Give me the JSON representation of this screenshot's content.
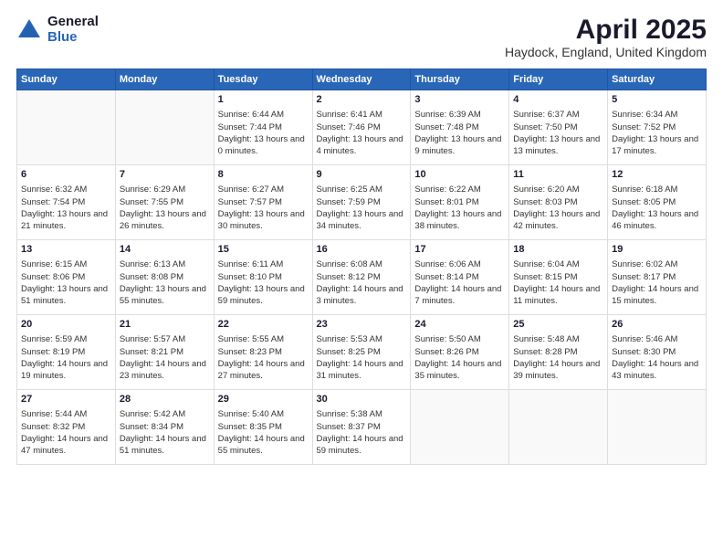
{
  "header": {
    "logo_general": "General",
    "logo_blue": "Blue",
    "month_year": "April 2025",
    "location": "Haydock, England, United Kingdom"
  },
  "weekdays": [
    "Sunday",
    "Monday",
    "Tuesday",
    "Wednesday",
    "Thursday",
    "Friday",
    "Saturday"
  ],
  "weeks": [
    [
      {
        "day": "",
        "info": ""
      },
      {
        "day": "",
        "info": ""
      },
      {
        "day": "1",
        "info": "Sunrise: 6:44 AM\nSunset: 7:44 PM\nDaylight: 13 hours and 0 minutes."
      },
      {
        "day": "2",
        "info": "Sunrise: 6:41 AM\nSunset: 7:46 PM\nDaylight: 13 hours and 4 minutes."
      },
      {
        "day": "3",
        "info": "Sunrise: 6:39 AM\nSunset: 7:48 PM\nDaylight: 13 hours and 9 minutes."
      },
      {
        "day": "4",
        "info": "Sunrise: 6:37 AM\nSunset: 7:50 PM\nDaylight: 13 hours and 13 minutes."
      },
      {
        "day": "5",
        "info": "Sunrise: 6:34 AM\nSunset: 7:52 PM\nDaylight: 13 hours and 17 minutes."
      }
    ],
    [
      {
        "day": "6",
        "info": "Sunrise: 6:32 AM\nSunset: 7:54 PM\nDaylight: 13 hours and 21 minutes."
      },
      {
        "day": "7",
        "info": "Sunrise: 6:29 AM\nSunset: 7:55 PM\nDaylight: 13 hours and 26 minutes."
      },
      {
        "day": "8",
        "info": "Sunrise: 6:27 AM\nSunset: 7:57 PM\nDaylight: 13 hours and 30 minutes."
      },
      {
        "day": "9",
        "info": "Sunrise: 6:25 AM\nSunset: 7:59 PM\nDaylight: 13 hours and 34 minutes."
      },
      {
        "day": "10",
        "info": "Sunrise: 6:22 AM\nSunset: 8:01 PM\nDaylight: 13 hours and 38 minutes."
      },
      {
        "day": "11",
        "info": "Sunrise: 6:20 AM\nSunset: 8:03 PM\nDaylight: 13 hours and 42 minutes."
      },
      {
        "day": "12",
        "info": "Sunrise: 6:18 AM\nSunset: 8:05 PM\nDaylight: 13 hours and 46 minutes."
      }
    ],
    [
      {
        "day": "13",
        "info": "Sunrise: 6:15 AM\nSunset: 8:06 PM\nDaylight: 13 hours and 51 minutes."
      },
      {
        "day": "14",
        "info": "Sunrise: 6:13 AM\nSunset: 8:08 PM\nDaylight: 13 hours and 55 minutes."
      },
      {
        "day": "15",
        "info": "Sunrise: 6:11 AM\nSunset: 8:10 PM\nDaylight: 13 hours and 59 minutes."
      },
      {
        "day": "16",
        "info": "Sunrise: 6:08 AM\nSunset: 8:12 PM\nDaylight: 14 hours and 3 minutes."
      },
      {
        "day": "17",
        "info": "Sunrise: 6:06 AM\nSunset: 8:14 PM\nDaylight: 14 hours and 7 minutes."
      },
      {
        "day": "18",
        "info": "Sunrise: 6:04 AM\nSunset: 8:15 PM\nDaylight: 14 hours and 11 minutes."
      },
      {
        "day": "19",
        "info": "Sunrise: 6:02 AM\nSunset: 8:17 PM\nDaylight: 14 hours and 15 minutes."
      }
    ],
    [
      {
        "day": "20",
        "info": "Sunrise: 5:59 AM\nSunset: 8:19 PM\nDaylight: 14 hours and 19 minutes."
      },
      {
        "day": "21",
        "info": "Sunrise: 5:57 AM\nSunset: 8:21 PM\nDaylight: 14 hours and 23 minutes."
      },
      {
        "day": "22",
        "info": "Sunrise: 5:55 AM\nSunset: 8:23 PM\nDaylight: 14 hours and 27 minutes."
      },
      {
        "day": "23",
        "info": "Sunrise: 5:53 AM\nSunset: 8:25 PM\nDaylight: 14 hours and 31 minutes."
      },
      {
        "day": "24",
        "info": "Sunrise: 5:50 AM\nSunset: 8:26 PM\nDaylight: 14 hours and 35 minutes."
      },
      {
        "day": "25",
        "info": "Sunrise: 5:48 AM\nSunset: 8:28 PM\nDaylight: 14 hours and 39 minutes."
      },
      {
        "day": "26",
        "info": "Sunrise: 5:46 AM\nSunset: 8:30 PM\nDaylight: 14 hours and 43 minutes."
      }
    ],
    [
      {
        "day": "27",
        "info": "Sunrise: 5:44 AM\nSunset: 8:32 PM\nDaylight: 14 hours and 47 minutes."
      },
      {
        "day": "28",
        "info": "Sunrise: 5:42 AM\nSunset: 8:34 PM\nDaylight: 14 hours and 51 minutes."
      },
      {
        "day": "29",
        "info": "Sunrise: 5:40 AM\nSunset: 8:35 PM\nDaylight: 14 hours and 55 minutes."
      },
      {
        "day": "30",
        "info": "Sunrise: 5:38 AM\nSunset: 8:37 PM\nDaylight: 14 hours and 59 minutes."
      },
      {
        "day": "",
        "info": ""
      },
      {
        "day": "",
        "info": ""
      },
      {
        "day": "",
        "info": ""
      }
    ]
  ]
}
